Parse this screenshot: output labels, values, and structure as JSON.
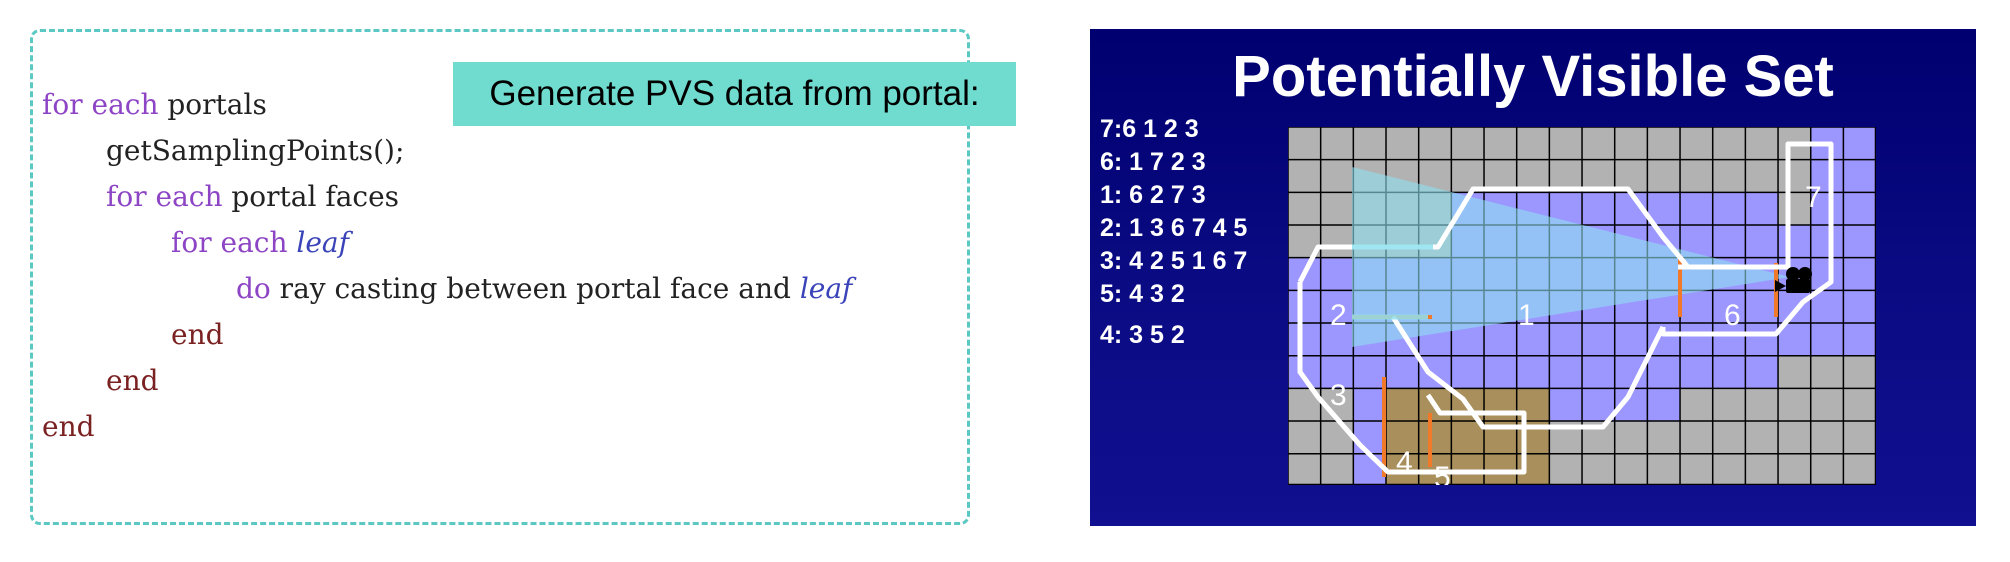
{
  "caption": "Generate PVS data from portal:",
  "code": {
    "line1": {
      "kw": "for each",
      "rest": " portals"
    },
    "line2": {
      "text": "getSamplingPoints();"
    },
    "line3": {
      "kw": "for each",
      "rest": " portal faces"
    },
    "line4": {
      "kw": "for each",
      "var": "leaf"
    },
    "line5": {
      "kw": "do",
      "rest": " ray casting between portal face and ",
      "var": "leaf"
    },
    "line6": {
      "text": "end"
    },
    "line7": {
      "text": "end"
    },
    "line8": {
      "text": "end"
    }
  },
  "slide": {
    "title": "Potentially Visible Set",
    "pvs_list": [
      "7:6 1 2 3",
      "6: 1 7 2 3",
      "1: 6 2 7 3",
      "2: 1 3 6 7 4 5",
      "3: 4 2 5 1 6 7",
      "5: 4 3 2",
      "4: 3 5 2"
    ],
    "region_labels": [
      "1",
      "2",
      "3",
      "4",
      "5",
      "6",
      "7"
    ],
    "camera_icon": "video-camera-icon",
    "colors": {
      "background": "#000070",
      "grid_cell": "#b2b2b2",
      "visible_cell": "#9c96ff",
      "low_room": "#a88f5c",
      "view_frustum": "#8fe0f0",
      "portal": "#f07a2a",
      "region_outline": "#ffffff"
    }
  }
}
